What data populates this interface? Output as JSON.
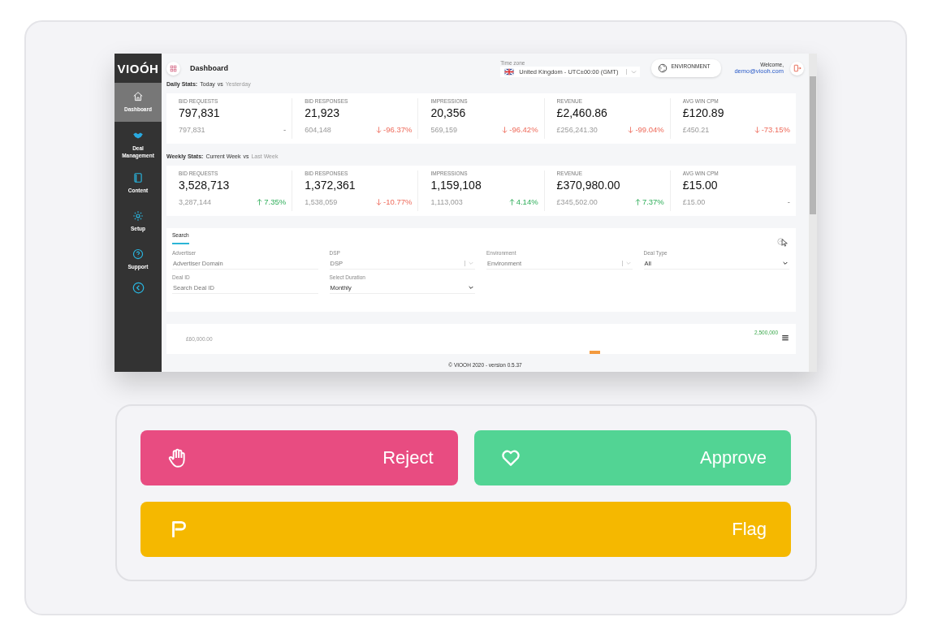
{
  "app": {
    "logo": "VIOÓH",
    "sidebar": [
      {
        "label": "Dashboard",
        "selected": true
      },
      {
        "label": "Deal Management",
        "selected": false
      },
      {
        "label": "Content",
        "selected": false
      },
      {
        "label": "Setup",
        "selected": false
      },
      {
        "label": "Support",
        "selected": false
      }
    ],
    "header": {
      "title": "Dashboard",
      "timezone_label": "Time zone",
      "timezone": "United Kingdom - UTC±00:00 (GMT)",
      "environment": "ENVIRONMENT",
      "welcome": "Welcome,",
      "user": "demo@viooh.com"
    },
    "stat_sections": [
      {
        "title": "Daily Stats:",
        "current": "Today",
        "vs": "vs",
        "previous": "Yesterday",
        "cards": [
          {
            "label": "BID REQUESTS",
            "value": "797,831",
            "previous": "797,831",
            "change": "-",
            "kind": "flat"
          },
          {
            "label": "BID RESPONSES",
            "value": "21,923",
            "previous": "604,148",
            "change": "-96.37%",
            "kind": "down"
          },
          {
            "label": "IMPRESSIONS",
            "value": "20,356",
            "previous": "569,159",
            "change": "-96.42%",
            "kind": "down"
          },
          {
            "label": "REVENUE",
            "value": "£2,460.86",
            "previous": "£256,241.30",
            "change": "-99.04%",
            "kind": "down"
          },
          {
            "label": "AVG WIN CPM",
            "value": "£120.89",
            "previous": "£450.21",
            "change": "-73.15%",
            "kind": "down"
          }
        ]
      },
      {
        "title": "Weekly Stats:",
        "current": "Current Week",
        "vs": "vs",
        "previous": "Last Week",
        "cards": [
          {
            "label": "BID REQUESTS",
            "value": "3,528,713",
            "previous": "3,287,144",
            "change": "7.35%",
            "kind": "up"
          },
          {
            "label": "BID RESPONSES",
            "value": "1,372,361",
            "previous": "1,538,059",
            "change": "-10.77%",
            "kind": "down"
          },
          {
            "label": "IMPRESSIONS",
            "value": "1,159,108",
            "previous": "1,113,003",
            "change": "4.14%",
            "kind": "up"
          },
          {
            "label": "REVENUE",
            "value": "£370,980.00",
            "previous": "£345,502.00",
            "change": "7.37%",
            "kind": "up"
          },
          {
            "label": "AVG WIN CPM",
            "value": "£15.00",
            "previous": "£15.00",
            "change": "-",
            "kind": "flat"
          }
        ]
      }
    ],
    "search": {
      "tab": {
        "label": "Search",
        "selected": true
      },
      "fields": [
        {
          "kind": "text",
          "label": "Advertiser",
          "placeholder": "Advertiser Domain"
        },
        {
          "kind": "combo",
          "label": "DSP",
          "placeholder": "DSP"
        },
        {
          "kind": "combo",
          "label": "Environment",
          "placeholder": "Environment"
        },
        {
          "kind": "select",
          "label": "Deal Type",
          "value": "All"
        },
        {
          "kind": "text",
          "label": "Deal ID",
          "placeholder": "Search Deal ID"
        },
        {
          "kind": "select",
          "label": "Select Duration",
          "value": "Monthly"
        }
      ]
    },
    "chart": {
      "left_axis_label": "£60,000.00",
      "right_axis_label": "2,500,000"
    },
    "footer": "© VIOOH 2020 - version 0.5.37"
  },
  "actions": [
    {
      "kind": "reject",
      "label": "Reject"
    },
    {
      "kind": "approve",
      "label": "Approve"
    },
    {
      "kind": "flag",
      "label": "Flag"
    }
  ]
}
